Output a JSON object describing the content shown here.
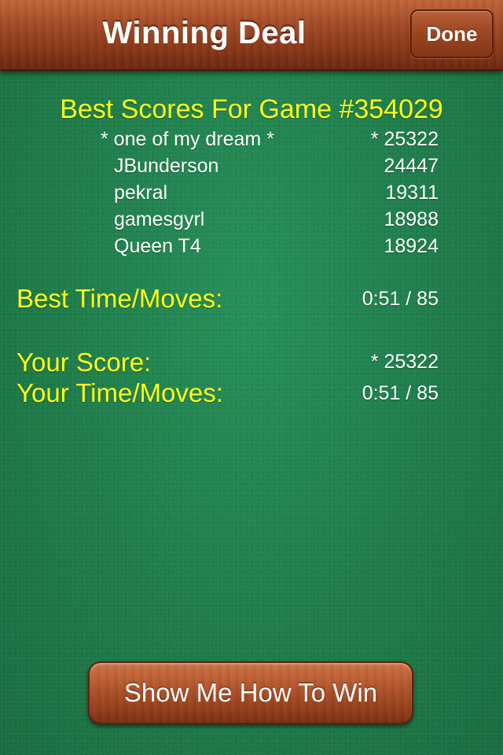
{
  "navbar": {
    "title": "Winning Deal",
    "done_label": "Done"
  },
  "best_scores": {
    "title": "Best Scores For Game #354029",
    "rows": [
      {
        "name": "* one of my dream *",
        "score": "* 25322"
      },
      {
        "name": "JBunderson",
        "score": "24447"
      },
      {
        "name": "pekral",
        "score": "19311"
      },
      {
        "name": "gamesgyrl",
        "score": "18988"
      },
      {
        "name": "Queen T4",
        "score": "18924"
      }
    ]
  },
  "best_time": {
    "label": "Best Time/Moves:",
    "value": "0:51 / 85"
  },
  "your_score": {
    "label": "Your Score:",
    "value": "* 25322"
  },
  "your_time": {
    "label": "Your Time/Moves:",
    "value": "0:51 / 85"
  },
  "show_button": {
    "label": "Show Me How To Win"
  },
  "colors": {
    "felt": "#1f7a48",
    "highlight_text": "#ffff1a",
    "wood": "#a34b26"
  }
}
